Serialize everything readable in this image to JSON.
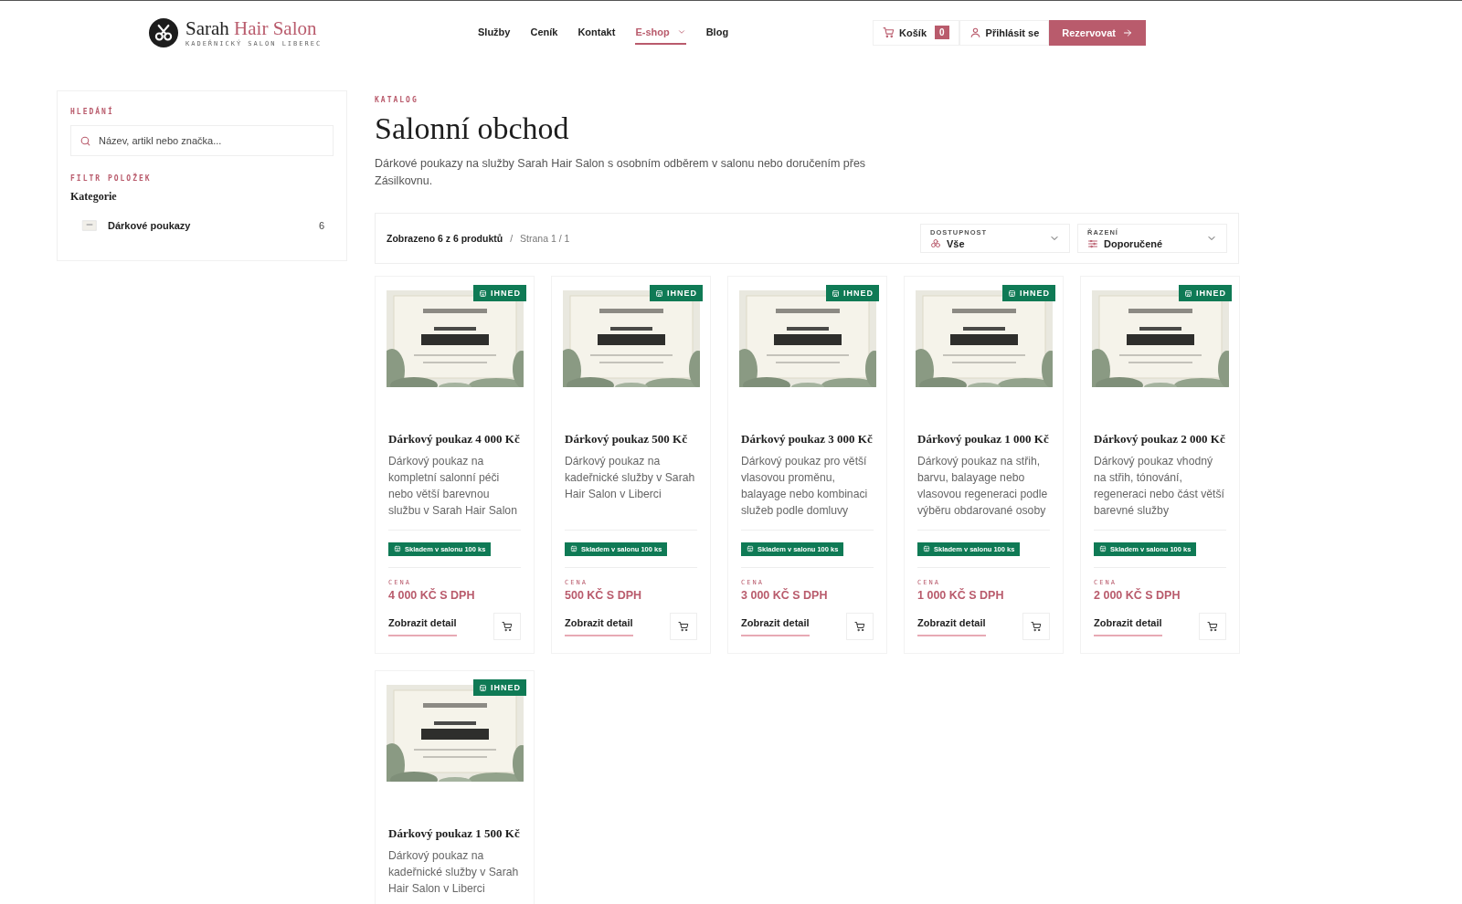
{
  "header": {
    "brand": {
      "name": "Sarah",
      "name_accent": "Hair Salon",
      "tagline": "KADEŘNICKÝ SALON LIBEREC"
    },
    "nav": [
      {
        "label": "Služby",
        "selected": false,
        "dropdown": false
      },
      {
        "label": "Ceník",
        "selected": false,
        "dropdown": false
      },
      {
        "label": "Kontakt",
        "selected": false,
        "dropdown": false
      },
      {
        "label": "E-shop",
        "selected": true,
        "dropdown": true
      },
      {
        "label": "Blog",
        "selected": false,
        "dropdown": false
      }
    ],
    "cart": {
      "label": "Košík",
      "count": "0"
    },
    "login": {
      "label": "Přihlásit se"
    },
    "reserve": {
      "label": "Rezervovat"
    }
  },
  "sidebar": {
    "search_heading": "HLEDÁNÍ",
    "search": {
      "placeholder": "Název, artikl nebo značka..."
    },
    "filter_heading": "FILTR POLOŽEK",
    "category_heading": "Kategorie",
    "categories": [
      {
        "label": "Dárkové poukazy",
        "count": "6"
      }
    ]
  },
  "catalog": {
    "eyebrow": "KATALOG",
    "title": "Salonní obchod",
    "description": "Dárkové poukazy na služby Sarah Hair Salon s osobním odběrem v salonu nebo doručením přes Zásilkovnu.",
    "toolbar": {
      "shown": "Zobrazeno 6 z 6 produktů",
      "separator": "/",
      "page": "Strana 1 / 1",
      "filters": [
        {
          "kind": "availability",
          "label": "DOSTUPNOST",
          "value": "Vše"
        },
        {
          "kind": "sort",
          "label": "ŘAZENÍ",
          "value": "Doporučené"
        }
      ]
    },
    "products": [
      {
        "badge": "IHNED",
        "title": "Dárkový poukaz 4 000 Kč",
        "description": "Dárkový poukaz na kompletní salonní péči nebo větší barevnou službu v Sarah Hair Salon",
        "stock": "Skladem v salonu 100 ks",
        "price_label": "CENA",
        "price": "4 000 KČ S DPH",
        "detail": "Zobrazit detail"
      },
      {
        "badge": "IHNED",
        "title": "Dárkový poukaz 500 Kč",
        "description": "Dárkový poukaz na kadeřnické služby v Sarah Hair Salon v Liberci",
        "stock": "Skladem v salonu 100 ks",
        "price_label": "CENA",
        "price": "500 KČ S DPH",
        "detail": "Zobrazit detail"
      },
      {
        "badge": "IHNED",
        "title": "Dárkový poukaz 3 000 Kč",
        "description": "Dárkový poukaz pro větší vlasovou proměnu, balayage nebo kombinaci služeb podle domluvy",
        "stock": "Skladem v salonu 100 ks",
        "price_label": "CENA",
        "price": "3 000 KČ S DPH",
        "detail": "Zobrazit detail"
      },
      {
        "badge": "IHNED",
        "title": "Dárkový poukaz 1 000 Kč",
        "description": "Dárkový poukaz na střih, barvu, balayage nebo vlasovou regeneraci podle výběru obdarované osoby",
        "stock": "Skladem v salonu 100 ks",
        "price_label": "CENA",
        "price": "1 000 KČ S DPH",
        "detail": "Zobrazit detail"
      },
      {
        "badge": "IHNED",
        "title": "Dárkový poukaz 2 000 Kč",
        "description": "Dárkový poukaz vhodný na střih, tónování, regeneraci nebo část větší barevné služby",
        "stock": "Skladem v salonu 100 ks",
        "price_label": "CENA",
        "price": "2 000 KČ S DPH",
        "detail": "Zobrazit detail"
      },
      {
        "badge": "IHNED",
        "title": "Dárkový poukaz 1 500 Kč",
        "description": "Dárkový poukaz na kadeřnické služby v Sarah Hair Salon v Liberci"
      }
    ]
  }
}
